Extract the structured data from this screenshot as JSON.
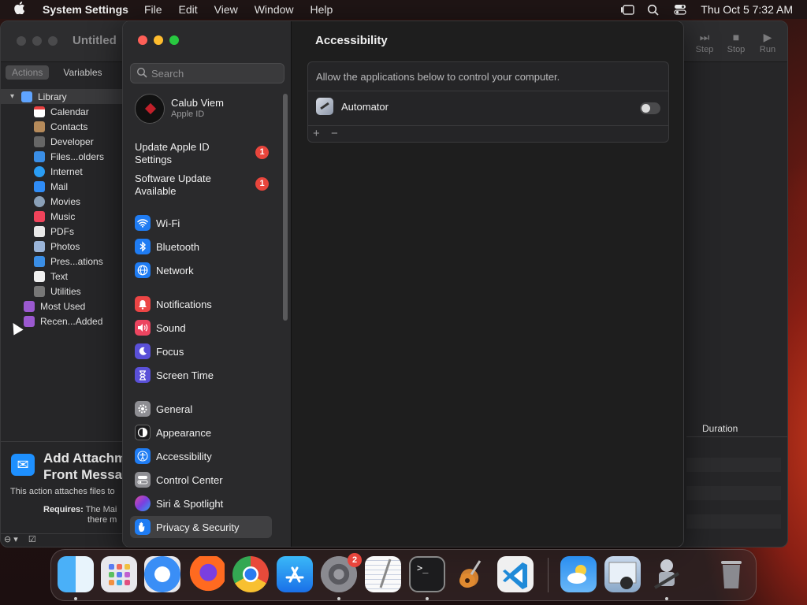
{
  "menubar": {
    "app_name": "System Settings",
    "items": [
      "File",
      "Edit",
      "View",
      "Window",
      "Help"
    ],
    "datetime": "Thu Oct 5  7:32 AM"
  },
  "automator": {
    "title": "Untitled",
    "toolbar": [
      "Step",
      "Stop",
      "Run"
    ],
    "tabs": [
      "Actions",
      "Variables"
    ],
    "library": {
      "root": "Library",
      "children": [
        "Calendar",
        "Contacts",
        "Developer",
        "Files...olders",
        "Internet",
        "Mail",
        "Movies",
        "Music",
        "PDFs",
        "Photos",
        "Pres...ations",
        "Text",
        "Utilities"
      ],
      "folders": [
        "Most Used",
        "Recen...Added"
      ]
    },
    "info": {
      "title_line1": "Add Attachm",
      "title_line2": "Front Messa",
      "desc": "This action attaches files to",
      "requires_label": "Requires:",
      "requires_text1": "The Mai",
      "requires_text2": "there m"
    },
    "log_column": "Duration"
  },
  "settings": {
    "search_placeholder": "Search",
    "user": {
      "name": "Calub Viem",
      "sub": "Apple ID"
    },
    "notices": [
      {
        "text": "Update Apple ID Settings",
        "badge": "1"
      },
      {
        "text": "Software Update Available",
        "badge": "1"
      }
    ],
    "nav": [
      {
        "label": "Wi-Fi",
        "icon": "wifi-icon",
        "color": "#1f7cf3"
      },
      {
        "label": "Bluetooth",
        "icon": "bluetooth-icon",
        "color": "#1f7cf3"
      },
      {
        "label": "Network",
        "icon": "globe-icon",
        "color": "#1f7cf3"
      },
      {
        "label": "Notifications",
        "icon": "bell-icon",
        "color": "#ec4545"
      },
      {
        "label": "Sound",
        "icon": "speaker-icon",
        "color": "#ec4560"
      },
      {
        "label": "Focus",
        "icon": "moon-icon",
        "color": "#5a50d8"
      },
      {
        "label": "Screen Time",
        "icon": "hourglass-icon",
        "color": "#5a50d8"
      },
      {
        "label": "General",
        "icon": "gear-icon",
        "color": "#8e8e93"
      },
      {
        "label": "Appearance",
        "icon": "appearance-icon",
        "color": "#1c1c1e"
      },
      {
        "label": "Accessibility",
        "icon": "accessibility-icon",
        "color": "#1f7cf3"
      },
      {
        "label": "Control Center",
        "icon": "control-center-icon",
        "color": "#8e8e93"
      },
      {
        "label": "Siri & Spotlight",
        "icon": "siri-icon",
        "color": "#7a3fe0"
      },
      {
        "label": "Privacy & Security",
        "icon": "hand-icon",
        "color": "#1f7cf3"
      }
    ],
    "selected": "Privacy & Security",
    "content": {
      "title": "Accessibility",
      "description": "Allow the applications below to control your computer.",
      "apps": [
        {
          "name": "Automator",
          "enabled": false
        }
      ],
      "add_label": "+",
      "remove_label": "−"
    }
  },
  "dock": {
    "apps": [
      "Finder",
      "Launchpad",
      "Safari",
      "Firefox",
      "Chrome",
      "App Store",
      "System Settings",
      "TextEdit",
      "Terminal",
      "GarageBand",
      "Visual Studio Code",
      "Weather",
      "Preview",
      "Automator",
      "Trash"
    ],
    "system_settings_badge": "2",
    "terminal_prompt": ">_"
  }
}
